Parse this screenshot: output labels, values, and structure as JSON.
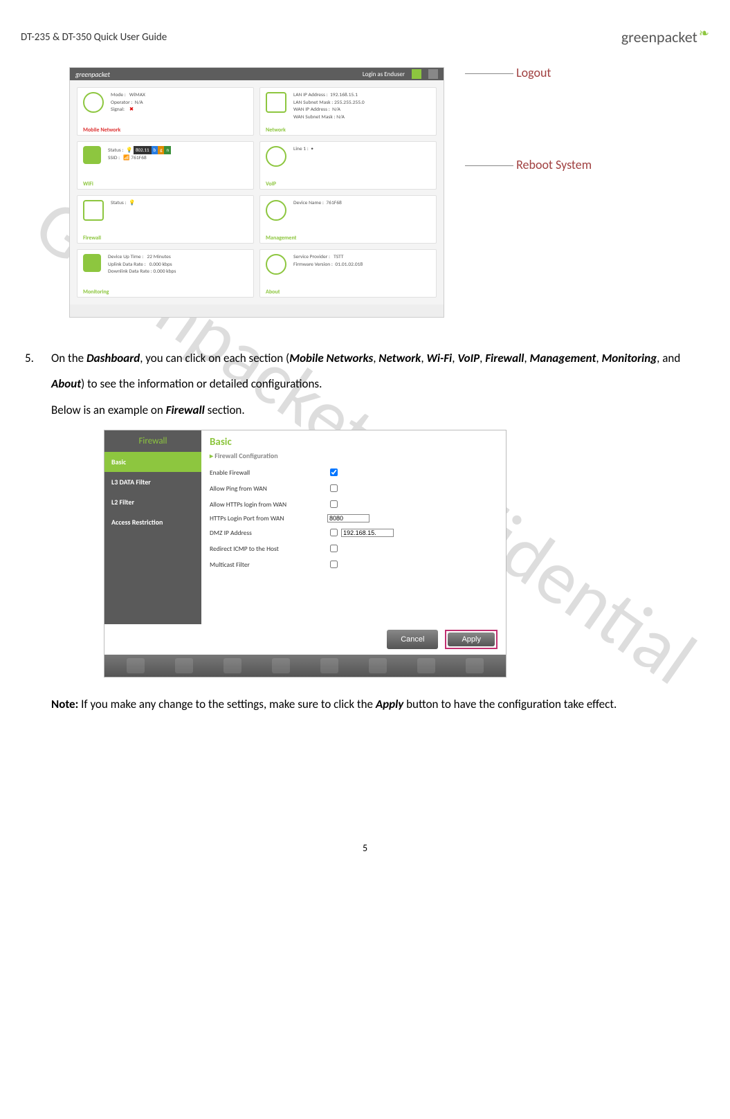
{
  "header": {
    "doc_title": "DT-235 & DT-350 Quick User Guide",
    "brand": "greenpacket"
  },
  "watermark": "Greenpacket Confidential",
  "annotations": {
    "logout": "Logout",
    "reboot": "Reboot System"
  },
  "dashboard": {
    "login_as": "Login as Enduser",
    "cards": {
      "mobile_network": {
        "title": "Mobile Network",
        "mode_label": "Mode :",
        "mode_value": "WiMAX",
        "operator_label": "Operator :",
        "operator_value": "N/A",
        "signal_label": "Signal:"
      },
      "network": {
        "title": "Network",
        "lan_ip_label": "LAN IP Address :",
        "lan_ip_value": "192.168.15.1",
        "lan_mask_label": "LAN Subnet Mask :",
        "lan_mask_value": "255.255.255.0",
        "wan_ip_label": "WAN IP Address :",
        "wan_ip_value": "N/A",
        "wan_mask_label": "WAN Subnet Mask :",
        "wan_mask_value": "N/A"
      },
      "wifi": {
        "title": "WiFi",
        "status_label": "Status :",
        "ssid_label": "SSID :",
        "ssid_value": "761F68",
        "badge": "802.11"
      },
      "voip": {
        "title": "VoIP",
        "line_label": "Line 1 :"
      },
      "firewall": {
        "title": "Firewall",
        "status_label": "Status :"
      },
      "management": {
        "title": "Management",
        "device_label": "Device Name :",
        "device_value": "761F68"
      },
      "monitoring": {
        "title": "Monitoring",
        "uptime_label": "Device Up Time :",
        "uptime_value": "22 Minutes",
        "uplink_label": "Uplink Data Rate :",
        "uplink_value": "0.000  kbps",
        "downlink_label": "Downlink Data Rate :",
        "downlink_value": "0.000  kbps"
      },
      "about": {
        "title": "About",
        "sp_label": "Service Provider :",
        "sp_value": "TSTT",
        "fw_label": "Firmware Version :",
        "fw_value": "01.01.02.018"
      }
    }
  },
  "step5": {
    "num": "5.",
    "t1": "On the ",
    "dashboard": "Dashboard",
    "t2": ", you can click on each section (",
    "s1": "Mobile Networks",
    "s2": "Network",
    "s3": "Wi-Fi",
    "s4": "VoIP",
    "s5": "Firewall",
    "s6": "Management",
    "s7": "Monitoring",
    "and": ", and ",
    "s8": "About",
    "t3": ") to see the information or detailed configurations.",
    "t4": "Below is an example on ",
    "fw": "Firewall",
    "t5": " section."
  },
  "firewall_page": {
    "side_header": "Firewall",
    "side_items": [
      "Basic",
      "L3 DATA Filter",
      "L2 Filter",
      "Access Restriction"
    ],
    "main_title": "Basic",
    "subtitle": "Firewall Configuration",
    "rows": {
      "enable": "Enable Firewall",
      "ping": "Allow Ping from WAN",
      "https": "Allow HTTPs login from WAN",
      "port_label": "HTTPs Login Port from WAN",
      "port_value": "8080",
      "dmz_label": "DMZ IP Address",
      "dmz_value": "192.168.15.",
      "redirect": "Redirect ICMP to the Host",
      "multicast": "Multicast Filter"
    },
    "cancel": "Cancel",
    "apply": "Apply"
  },
  "note": {
    "label": "Note:",
    "t1": " If you make any change to the settings, make sure to click the ",
    "apply": "Apply",
    "t2": " button to have the configuration take effect."
  },
  "page_number": "5"
}
